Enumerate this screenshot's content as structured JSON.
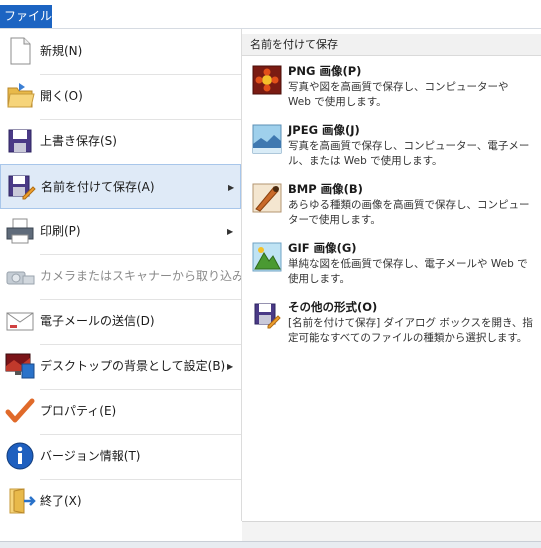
{
  "file_tab": {
    "label": "ファイル"
  },
  "menu": {
    "items": [
      {
        "label": "新規(N)"
      },
      {
        "label": "開く(O)"
      },
      {
        "label": "上書き保存(S)"
      },
      {
        "label": "名前を付けて保存(A)",
        "arrow": "▶"
      },
      {
        "label": "印刷(P)",
        "arrow": "▶"
      },
      {
        "label": "カメラまたはスキャナーから取り込み(M)"
      },
      {
        "label": "電子メールの送信(D)"
      },
      {
        "label": "デスクトップの背景として設定(B)",
        "arrow": "▶"
      },
      {
        "label": "プロパティ(E)"
      },
      {
        "label": "バージョン情報(T)"
      },
      {
        "label": "終了(X)"
      }
    ]
  },
  "submenu": {
    "title": "名前を付けて保存",
    "options": [
      {
        "title": "PNG 画像(P)",
        "desc": "写真や図を高画質で保存し、コンピューターや Web で使用します。"
      },
      {
        "title": "JPEG 画像(J)",
        "desc": "写真を高画質で保存し、コンピューター、電子メール、または Web で使用します。"
      },
      {
        "title": "BMP 画像(B)",
        "desc": "あらゆる種類の画像を高画質で保存し、コンピューターで使用します。"
      },
      {
        "title": "GIF 画像(G)",
        "desc": "単純な図を低画質で保存し、電子メールや Web で使用します。"
      },
      {
        "title": "その他の形式(O)",
        "desc": "[名前を付けて保存] ダイアログ ボックスを開き、指定可能なすべてのファイルの種類から選択します。"
      }
    ]
  },
  "colors": {
    "accent": "#1c64c2",
    "selected_bg": "#dfeaf7",
    "selected_border": "#a8c6ea"
  }
}
